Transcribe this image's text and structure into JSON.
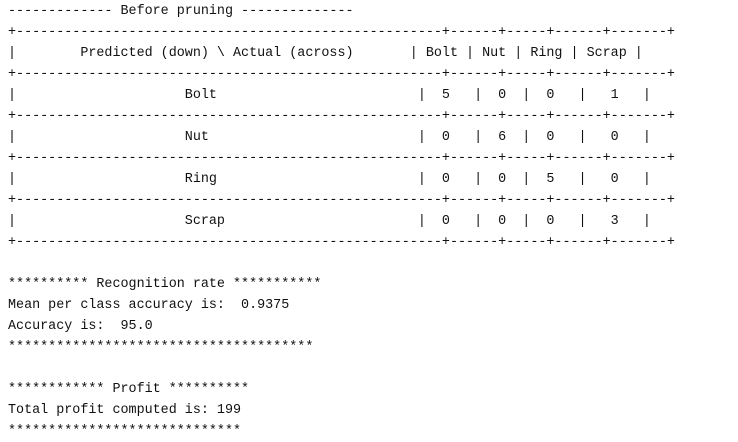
{
  "console": {
    "lines": [
      "------------- Before pruning --------------",
      "+-----------------------------------------------------+------+-----+------+-------+",
      "|        Predicted (down) \\ Actual (across)       | Bolt | Nut | Ring | Scrap |",
      "+-----------------------------------------------------+------+-----+------+-------+",
      "|                     Bolt                         |  5   |  0  |  0   |   1   |",
      "+-----------------------------------------------------+------+-----+------+-------+",
      "|                     Nut                          |  0   |  6  |  0   |   0   |",
      "+-----------------------------------------------------+------+-----+------+-------+",
      "|                     Ring                         |  0   |  0  |  5   |   0   |",
      "+-----------------------------------------------------+------+-----+------+-------+",
      "|                     Scrap                        |  0   |  0  |  0   |   3   |",
      "+-----------------------------------------------------+------+-----+------+-------+",
      "",
      "********** Recognition rate ***********",
      "Mean per class accuracy is:  0.9375",
      "Accuracy is:  95.0",
      "**************************************",
      "",
      "************ Profit **********",
      "Total profit computed is: 199",
      "*****************************"
    ]
  }
}
